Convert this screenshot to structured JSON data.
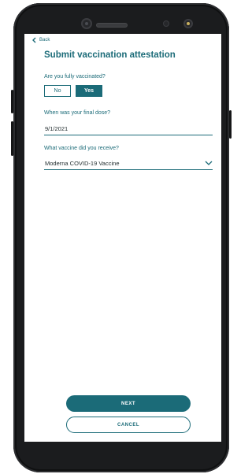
{
  "nav": {
    "back_label": "Back"
  },
  "page": {
    "title": "Submit vaccination attestation"
  },
  "q1": {
    "label": "Are you fully vaccinated?",
    "options": [
      "No",
      "Yes"
    ],
    "selected": "Yes"
  },
  "q2": {
    "label": "When was your final dose?",
    "value": "9/1/2021"
  },
  "q3": {
    "label": "What vaccine did you receive?",
    "value": "Moderna COVID-19 Vaccine"
  },
  "actions": {
    "next_label": "NEXT",
    "cancel_label": "CANCEL"
  },
  "theme": {
    "accent": "#1b6b78",
    "phone_body": "#1b1c1e"
  },
  "icons": {
    "back": "chevron-left-icon",
    "dropdown": "chevron-down-icon"
  }
}
